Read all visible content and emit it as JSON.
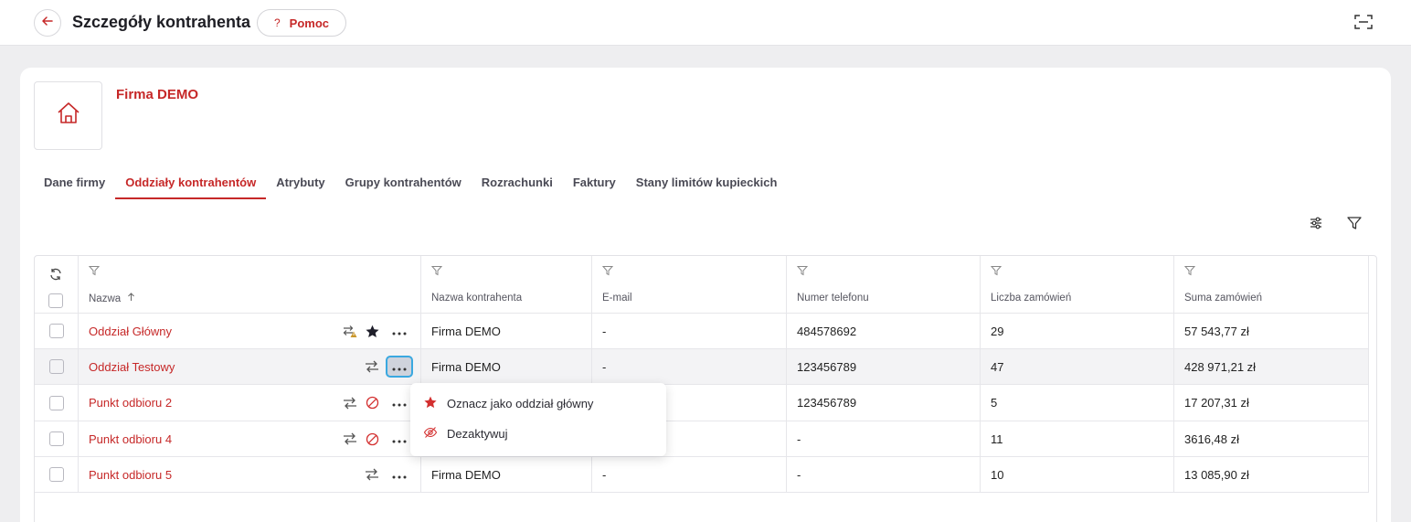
{
  "header": {
    "title": "Szczegóły kontrahenta",
    "help_label": "Pomoc",
    "help_glyph": "?"
  },
  "company": {
    "name": "Firma DEMO"
  },
  "tabs": [
    {
      "label": "Dane firmy",
      "active": false
    },
    {
      "label": "Oddziały kontrahentów",
      "active": true
    },
    {
      "label": "Atrybuty",
      "active": false
    },
    {
      "label": "Grupy kontrahentów",
      "active": false
    },
    {
      "label": "Rozrachunki",
      "active": false
    },
    {
      "label": "Faktury",
      "active": false
    },
    {
      "label": "Stany limitów kupieckich",
      "active": false
    }
  ],
  "table": {
    "columns": [
      "Nazwa",
      "Nazwa kontrahenta",
      "E-mail",
      "Numer telefonu",
      "Liczba zamówień",
      "Suma zamówień"
    ],
    "sort_column": "Nazwa",
    "sort_direction": "asc",
    "rows": [
      {
        "name": "Oddział Główny",
        "company": "Firma DEMO",
        "email": "-",
        "phone": "484578692",
        "orders": "29",
        "total": "57 543,77 zł",
        "icons": [
          "sync-warning-icon",
          "star-icon"
        ]
      },
      {
        "name": "Oddział Testowy",
        "company": "Firma DEMO",
        "email": "-",
        "phone": "123456789",
        "orders": "47",
        "total": "428 971,21 zł",
        "icons": [
          "transfer-icon"
        ]
      },
      {
        "name": "Punkt odbioru 2",
        "company": "",
        "email": "",
        "phone": "123456789",
        "orders": "5",
        "total": "17 207,31 zł",
        "icons": [
          "transfer-icon",
          "inactive-icon"
        ]
      },
      {
        "name": "Punkt odbioru 4",
        "company": "",
        "email": "",
        "phone": "-",
        "orders": "11",
        "total": "3616,48 zł",
        "icons": [
          "transfer-icon",
          "inactive-icon"
        ]
      },
      {
        "name": "Punkt odbioru 5",
        "company": "Firma DEMO",
        "email": "-",
        "phone": "-",
        "orders": "10",
        "total": "13 085,90 zł",
        "icons": [
          "transfer-icon"
        ]
      }
    ]
  },
  "context_menu": {
    "items": [
      {
        "label": "Oznacz jako oddział główny",
        "icon": "star-icon"
      },
      {
        "label": "Dezaktywuj",
        "icon": "eye-off-icon"
      }
    ]
  },
  "colors": {
    "accent": "#c62828",
    "focus": "#3aa8e0",
    "star_menu": "#d32f2f",
    "warning": "#c9962a"
  }
}
